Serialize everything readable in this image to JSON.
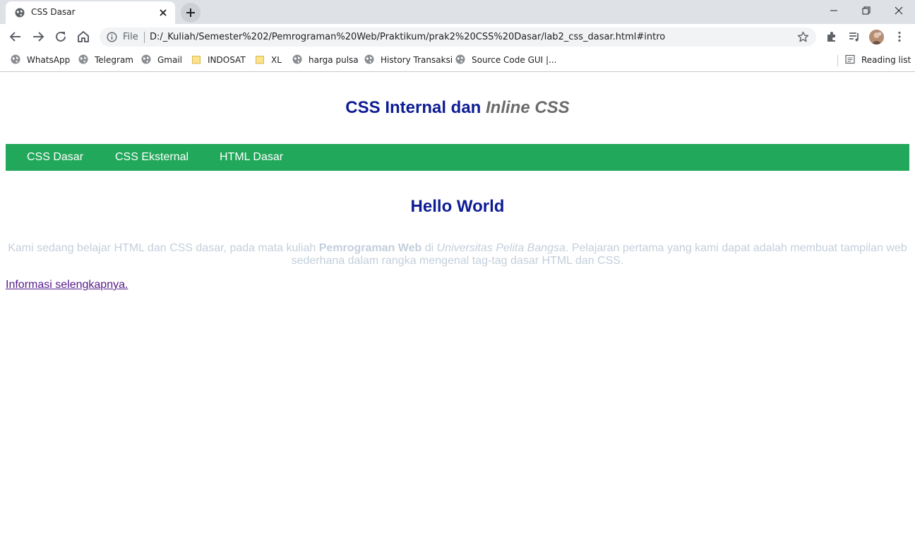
{
  "browser": {
    "tab": {
      "title": "CSS Dasar"
    },
    "address_bar": {
      "scheme_label": "File",
      "url": "D:/_Kuliah/Semester%202/Pemrograman%20Web/Praktikum/prak2%20CSS%20Dasar/lab2_css_dasar.html#intro"
    },
    "bookmarks": [
      {
        "label": "WhatsApp",
        "icon": "globe-icon"
      },
      {
        "label": "Telegram",
        "icon": "globe-icon"
      },
      {
        "label": "Gmail",
        "icon": "globe-icon"
      },
      {
        "label": "INDOSAT",
        "icon": "folder-icon"
      },
      {
        "label": "XL",
        "icon": "folder-icon"
      },
      {
        "label": "harga pulsa",
        "icon": "globe-icon"
      },
      {
        "label": "History Transaksi",
        "icon": "globe-icon"
      },
      {
        "label": "Source Code GUI |...",
        "icon": "globe-icon"
      }
    ],
    "reading_list": "Reading list"
  },
  "page": {
    "title_part1": "CSS Internal dan ",
    "title_part2": "Inline CSS",
    "nav": [
      "CSS Dasar",
      "CSS Eksternal",
      "HTML Dasar"
    ],
    "heading": "Hello World",
    "intro": {
      "text1": "Kami sedang belajar HTML dan CSS dasar, pada mata kuliah ",
      "bold": "Pemrograman Web",
      "text2": " di ",
      "italic": "Universitas Pelita Bangsa",
      "text3": ". Pelajaran pertama yang kami dapat adalah membuat tampilan web sederhana dalam rangka mengenal tag-tag dasar HTML dan CSS."
    },
    "more_link": "Informasi selengkapnya."
  },
  "colors": {
    "nav_background": "#21a85a",
    "heading_color": "#0d1c94",
    "intro_text_color": "#c3cfdc",
    "link_visited": "#551a8b"
  }
}
